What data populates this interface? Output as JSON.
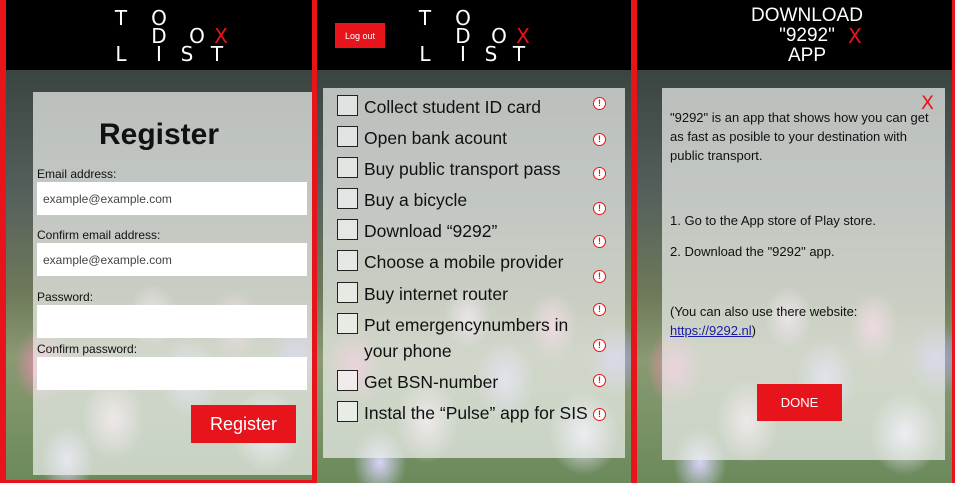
{
  "logo": {
    "row1": [
      "T",
      "O"
    ],
    "row2": [
      "D",
      "O",
      "X"
    ],
    "row3": [
      "L",
      "I",
      "S",
      "T"
    ]
  },
  "register": {
    "title": "Register",
    "email_label": "Email address:",
    "email_value": "example@example.com",
    "confirm_email_label": "Confirm email address:",
    "confirm_email_value": "example@example.com",
    "password_label": "Password:",
    "password_value": "",
    "confirm_password_label": "Confirm password:",
    "confirm_password_value": "",
    "submit_label": "Register"
  },
  "todo": {
    "logout_label": "Log out",
    "items": [
      {
        "label": "Collect student ID card"
      },
      {
        "label": "Open bank acount"
      },
      {
        "label": "Buy public transport pass"
      },
      {
        "label": "Buy a bicycle"
      },
      {
        "label": "Download “9292”"
      },
      {
        "label": "Choose a mobile provider"
      },
      {
        "label": "Buy internet router"
      },
      {
        "label": "Put emergencynumbers in your phone"
      },
      {
        "label": "Get BSN-number"
      },
      {
        "label": "Instal the “Pulse” app for SIS"
      }
    ],
    "info_glyph": "!"
  },
  "download": {
    "title_line1": "DOWNLOAD",
    "title_line2": "\"9292\"",
    "title_line3": "APP",
    "close_glyph": "X",
    "description": "\"9292\" is an app that shows how you can get as fast as posible to your destination with public transport.",
    "step1": "1. Go to the App store of Play store.",
    "step2": "2. Download the \"9292\" app.",
    "note": "(You can also use there website:",
    "link_text": "https://9292.nl",
    "note_end": ")",
    "done_label": "DONE"
  },
  "colors": {
    "accent_red": "#e8141c",
    "topbar": "#000000"
  }
}
